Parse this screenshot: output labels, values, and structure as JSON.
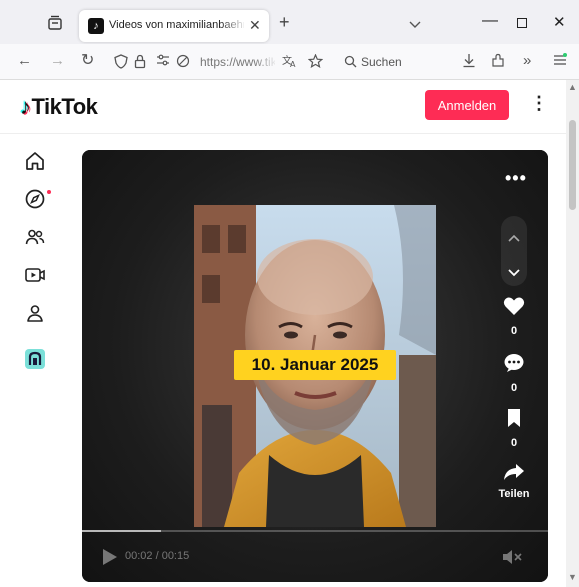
{
  "browser": {
    "tab_title": "Videos von maximilianbaehring",
    "address_url": "https://www.tiktok.com/@maximilianbaehring",
    "search_placeholder": "Suchen",
    "accent": "#f0f0f4"
  },
  "header": {
    "logo_text": "TikTok",
    "login_label": "Anmelden",
    "more_icon": "vertical-dots-icon",
    "brand_color": "#fe2c55"
  },
  "sidebar": {
    "items": [
      {
        "name": "home",
        "icon": "home-icon"
      },
      {
        "name": "explore",
        "icon": "compass-icon",
        "has_notification_dot": true
      },
      {
        "name": "following",
        "icon": "users-icon"
      },
      {
        "name": "live",
        "icon": "live-icon"
      },
      {
        "name": "profile",
        "icon": "profile-icon"
      },
      {
        "name": "app",
        "icon": "app-icon"
      }
    ]
  },
  "video": {
    "overlay_text": "10. Januar 2025",
    "likes": "0",
    "comments": "0",
    "bookmarks": "0",
    "share_label": "Teilen",
    "time": "00:02 / 00:15",
    "progress": 0.17
  }
}
